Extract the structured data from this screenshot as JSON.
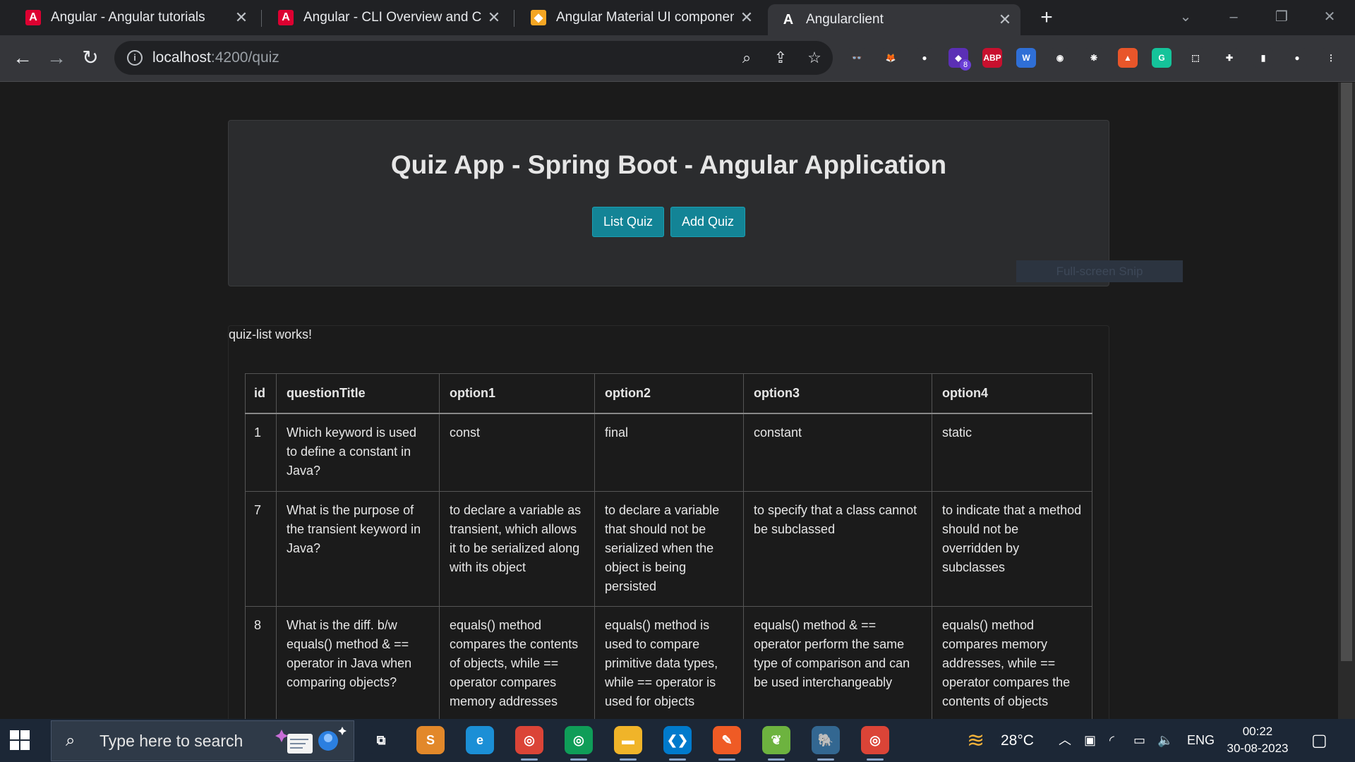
{
  "tabs": [
    {
      "title": "Angular - Angular tutorials",
      "favicon": "A",
      "favicon_color": "#dd0031",
      "active": false
    },
    {
      "title": "Angular - CLI Overview and Command",
      "favicon": "A",
      "favicon_color": "#dd0031",
      "active": false
    },
    {
      "title": "Angular Material UI component library",
      "favicon": "◆",
      "favicon_color": "#f5a623",
      "active": false
    },
    {
      "title": "Angularclient",
      "favicon": "A",
      "favicon_color": "#35363a",
      "active": true
    }
  ],
  "address": {
    "host": "localhost",
    "path": ":4200/quiz"
  },
  "extensions": [
    {
      "icon": "glasses-icon",
      "glyph": "👓",
      "color": "#35363a"
    },
    {
      "icon": "fox-icon",
      "glyph": "🦊",
      "color": "#35363a"
    },
    {
      "icon": "figure-icon",
      "glyph": "●",
      "color": "#35363a"
    },
    {
      "icon": "puzzle-purple-icon",
      "glyph": "◆",
      "color": "#5b2fb5",
      "badge": "8"
    },
    {
      "icon": "abp-icon",
      "glyph": "ABP",
      "color": "#c8102e"
    },
    {
      "icon": "wappalyzer-icon",
      "glyph": "W",
      "color": "#2f6fd6"
    },
    {
      "icon": "camera-icon",
      "glyph": "◉",
      "color": "#35363a"
    },
    {
      "icon": "openai-icon",
      "glyph": "❋",
      "color": "#35363a"
    },
    {
      "icon": "rocket-icon",
      "glyph": "▲",
      "color": "#e8562a"
    },
    {
      "icon": "grammarly-icon",
      "glyph": "G",
      "color": "#15c39a"
    },
    {
      "icon": "screenshot-icon",
      "glyph": "⬚",
      "color": "#35363a"
    },
    {
      "icon": "puzzle-icon",
      "glyph": "✚",
      "color": "#35363a"
    },
    {
      "icon": "sidepanel-icon",
      "glyph": "▮",
      "color": "#35363a"
    },
    {
      "icon": "profile-icon",
      "glyph": "●",
      "color": "#35363a"
    },
    {
      "icon": "menu-icon",
      "glyph": "⋮",
      "color": "#35363a"
    }
  ],
  "header": {
    "title": "Quiz App - Spring Boot - Angular Application",
    "list_label": "List Quiz",
    "add_label": "Add Quiz"
  },
  "snip_overlay": "Full-screen Snip",
  "quiz_list": {
    "status": "quiz-list works!",
    "columns": [
      "id",
      "questionTitle",
      "option1",
      "option2",
      "option3",
      "option4"
    ],
    "rows": [
      {
        "id": "1",
        "questionTitle": "Which keyword is used to define a constant in Java?",
        "option1": "const",
        "option2": "final",
        "option3": "constant",
        "option4": "static"
      },
      {
        "id": "7",
        "questionTitle": "What is the purpose of the transient keyword in Java?",
        "option1": "to declare a variable as transient, which allows it to be serialized along with its object",
        "option2": "to declare a variable that should not be serialized when the object is being persisted",
        "option3": "to specify that a class cannot be subclassed",
        "option4": "to indicate that a method should not be overridden by subclasses"
      },
      {
        "id": "8",
        "questionTitle": "What is the diff. b/w equals() method & == operator in Java when comparing objects?",
        "option1": "equals() method compares the contents of objects, while == operator compares memory addresses",
        "option2": "equals() method is used to compare primitive data types, while == operator is used for objects",
        "option3": "equals() method & == operator perform the same type of comparison and can be used interchangeably",
        "option4": "equals() method compares memory addresses, while == operator compares the contents of objects"
      }
    ]
  },
  "taskbar": {
    "search_placeholder": "Type here to search",
    "apps": [
      {
        "icon": "task-view-icon",
        "glyph": "⧉",
        "color": "#1c2736"
      },
      {
        "icon": "sublime-icon",
        "glyph": "S",
        "color": "#e2882a"
      },
      {
        "icon": "edge-icon",
        "glyph": "e",
        "color": "#1b8fd6"
      },
      {
        "icon": "chrome-icon",
        "glyph": "◎",
        "color": "#db4437"
      },
      {
        "icon": "chrome-profile-icon",
        "glyph": "◎",
        "color": "#0f9d58"
      },
      {
        "icon": "file-explorer-icon",
        "glyph": "▬",
        "color": "#f0b429"
      },
      {
        "icon": "vscode-icon",
        "glyph": "❮❯",
        "color": "#007acc"
      },
      {
        "icon": "postman-icon",
        "glyph": "✎",
        "color": "#ef5b25"
      },
      {
        "icon": "spring-icon",
        "glyph": "❦",
        "color": "#6db33f"
      },
      {
        "icon": "postgres-icon",
        "glyph": "🐘",
        "color": "#336791"
      },
      {
        "icon": "chrome-k-icon",
        "glyph": "◎",
        "color": "#db4437"
      }
    ],
    "weather": "28°C",
    "language": "ENG",
    "time": "00:22",
    "date": "30-08-2023"
  }
}
